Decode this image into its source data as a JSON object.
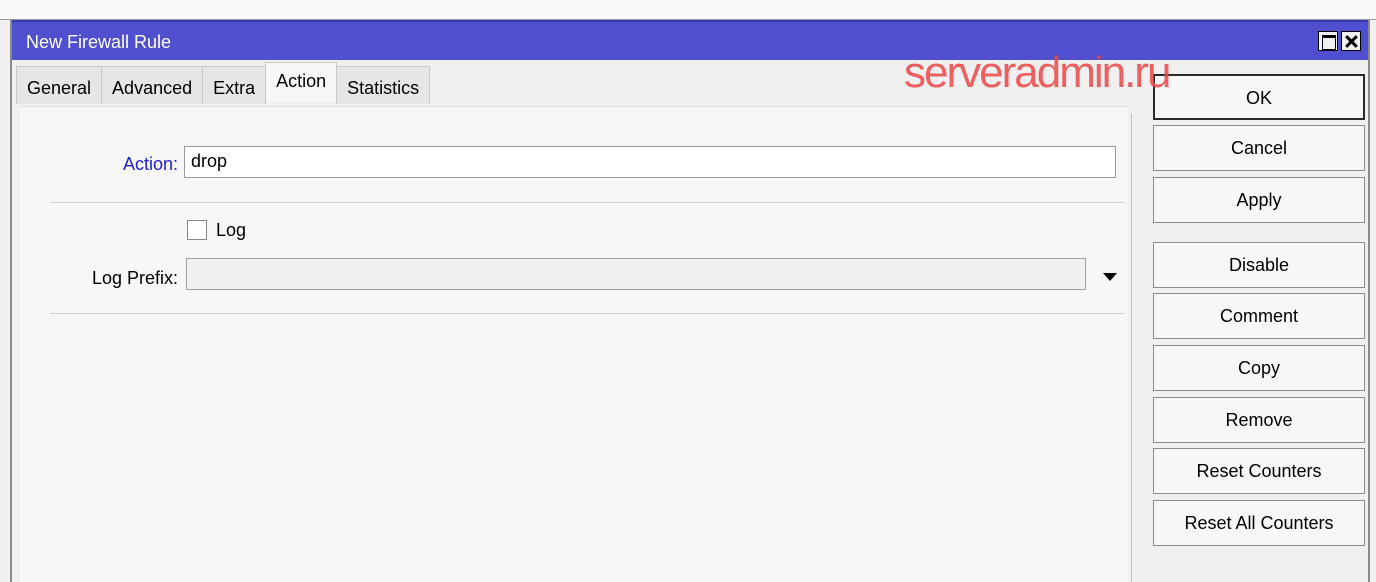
{
  "window": {
    "title": "New Firewall Rule"
  },
  "tabs": [
    {
      "label": "General"
    },
    {
      "label": "Advanced"
    },
    {
      "label": "Extra"
    },
    {
      "label": "Action"
    },
    {
      "label": "Statistics"
    }
  ],
  "active_tab": "Action",
  "form": {
    "action_label": "Action:",
    "action_value": "drop",
    "log_label": "Log",
    "log_checked": false,
    "log_prefix_label": "Log Prefix:",
    "log_prefix_value": ""
  },
  "watermark": "serveradmin.ru",
  "buttons": {
    "ok": "OK",
    "cancel": "Cancel",
    "apply": "Apply",
    "disable": "Disable",
    "comment": "Comment",
    "copy": "Copy",
    "remove": "Remove",
    "reset_counters": "Reset Counters",
    "reset_all_counters": "Reset All Counters"
  },
  "colors": {
    "titlebar": "#4f4fcf",
    "action_label": "#2020d0",
    "watermark": "#eb4646"
  }
}
